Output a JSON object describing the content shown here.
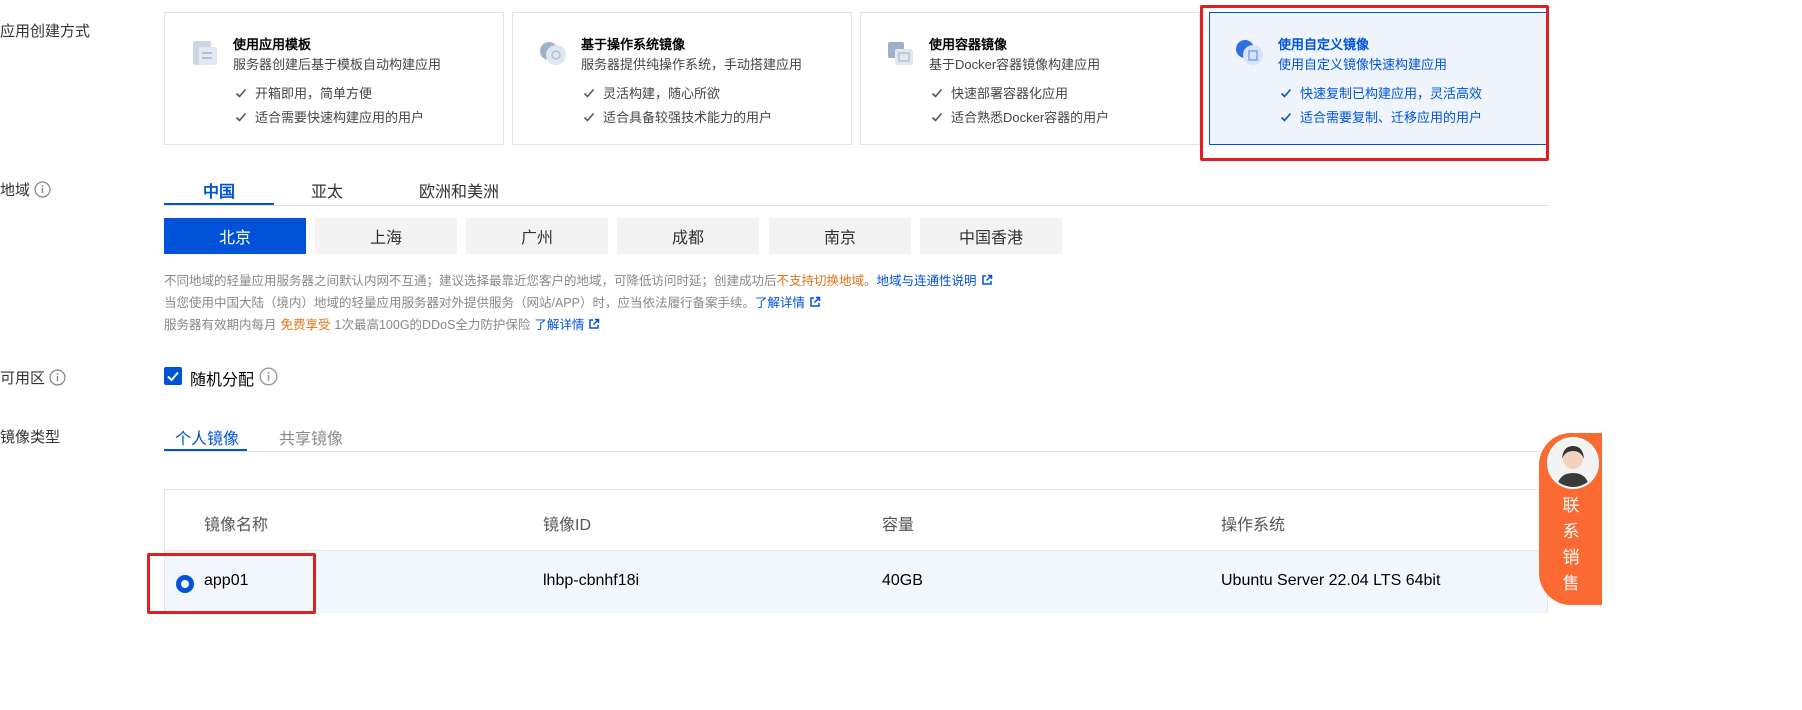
{
  "labels": {
    "creation_method": "应用创建方式",
    "region": "地域",
    "zone": "可用区",
    "image_type": "镜像类型"
  },
  "cards": [
    {
      "title": "使用应用模板",
      "desc": "服务器创建后基于模板自动构建应用",
      "features": [
        "开箱即用，简单方便",
        "适合需要快速构建应用的用户"
      ],
      "icon": "template-icon"
    },
    {
      "title": "基于操作系统镜像",
      "desc": "服务器提供纯操作系统，手动搭建应用",
      "features": [
        "灵活构建，随心所欲",
        "适合具备较强技术能力的用户"
      ],
      "icon": "os-image-icon"
    },
    {
      "title": "使用容器镜像",
      "desc": "基于Docker容器镜像构建应用",
      "features": [
        "快速部署容器化应用",
        "适合熟悉Docker容器的用户"
      ],
      "icon": "container-icon"
    },
    {
      "title": "使用自定义镜像",
      "desc": "使用自定义镜像快速构建应用",
      "features": [
        "快速复制已构建应用，灵活高效",
        "适合需要复制、迁移应用的用户"
      ],
      "icon": "custom-image-icon",
      "selected": true
    }
  ],
  "region_tabs": [
    "中国",
    "亚太",
    "欧洲和美洲"
  ],
  "region_tab_selected": "中国",
  "cities": [
    "北京",
    "上海",
    "广州",
    "成都",
    "南京",
    "中国香港"
  ],
  "city_selected": "北京",
  "notes": {
    "line1_pre": "不同地域的轻量应用服务器之间默认内网不互通；建议选择最靠近您客户的地域，可降低访问时延；创建成功后",
    "line1_orange": "不支持切换地域",
    "line1_mid": "。",
    "line1_link": "地域与连通性说明",
    "line2_pre": "当您使用中国大陆（境内）地域的轻量应用服务器对外提供服务（网站/APP）时，应当依法履行备案手续。",
    "line2_link": "了解详情",
    "line3_pre": "服务器有效期内每月",
    "line3_orange": "免费享受",
    "line3_mid": "1次最高100G的DDoS全力防护保险",
    "line3_link": "了解详情"
  },
  "zone": {
    "checkbox_label": "随机分配",
    "checked": true
  },
  "image_tabs": [
    "个人镜像",
    "共享镜像"
  ],
  "image_tab_selected": "个人镜像",
  "table": {
    "headers": [
      "镜像名称",
      "镜像ID",
      "容量",
      "操作系统"
    ],
    "rows": [
      {
        "name": "app01",
        "id": "lhbp-cbnhf18i",
        "size": "40GB",
        "os": "Ubuntu Server 22.04 LTS 64bit",
        "selected": true
      }
    ]
  },
  "contact": {
    "text": "联系销售"
  },
  "colors": {
    "primary": "#0052d9",
    "orange": "#e37318",
    "highlight": "#e02020",
    "contact": "#fb6a33"
  }
}
